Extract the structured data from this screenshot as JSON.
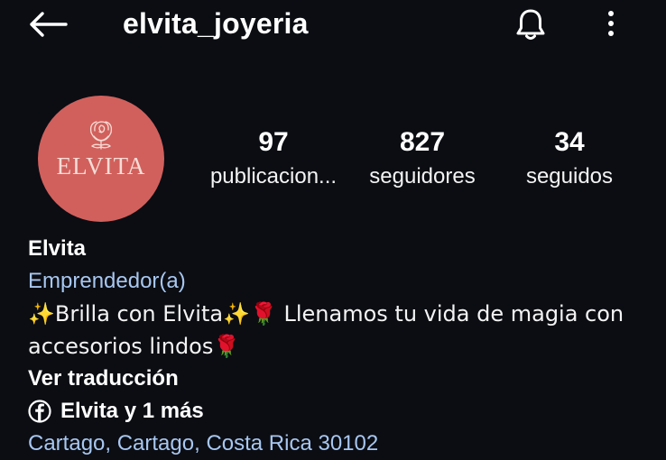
{
  "header": {
    "username": "elvita_joyeria",
    "icons": {
      "back": "back-arrow-icon",
      "bell": "bell-icon",
      "more": "more-vertical-icon"
    }
  },
  "avatar": {
    "brand_text": "ELVITA",
    "background": "#d1605c",
    "logo_icon": "rose-icon"
  },
  "stats": [
    {
      "value": "97",
      "label": "publicacion..."
    },
    {
      "value": "827",
      "label": "seguidores"
    },
    {
      "value": "34",
      "label": "seguidos"
    }
  ],
  "bio": {
    "name": "Elvita",
    "category": "Emprendedor(a)",
    "line1": "✨Brilla con Elvita✨🌹 Llenamos tu vida de magia con",
    "line2": "accesorios lindos🌹",
    "translate": "Ver traducción",
    "facebook_link": "Elvita y 1 más",
    "location": "Cartago, Cartago, Costa Rica 30102"
  },
  "colors": {
    "background": "#0b0d13",
    "link": "#a8c7f0",
    "text": "#ffffff"
  }
}
